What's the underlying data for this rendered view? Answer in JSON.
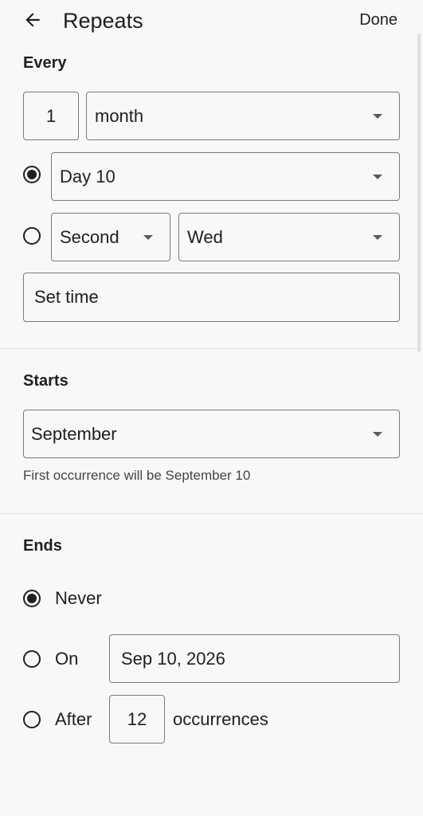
{
  "header": {
    "title": "Repeats",
    "done_label": "Done"
  },
  "every": {
    "label": "Every",
    "interval": "1",
    "unit": "month",
    "option_day": {
      "selected": true,
      "value": "Day 10"
    },
    "option_weekday": {
      "selected": false,
      "ordinal": "Second",
      "weekday": "Wed"
    },
    "set_time_placeholder": "Set time"
  },
  "starts": {
    "label": "Starts",
    "month": "September",
    "helper": "First occurrence will be September 10"
  },
  "ends": {
    "label": "Ends",
    "never_label": "Never",
    "on_label": "On",
    "on_date": "Sep 10, 2026",
    "after_label": "After",
    "after_count": "12",
    "occurrences_label": "occurrences",
    "selected": "never"
  },
  "icons": {
    "back": "arrow-left-icon",
    "dropdown": "caret-down-icon"
  }
}
